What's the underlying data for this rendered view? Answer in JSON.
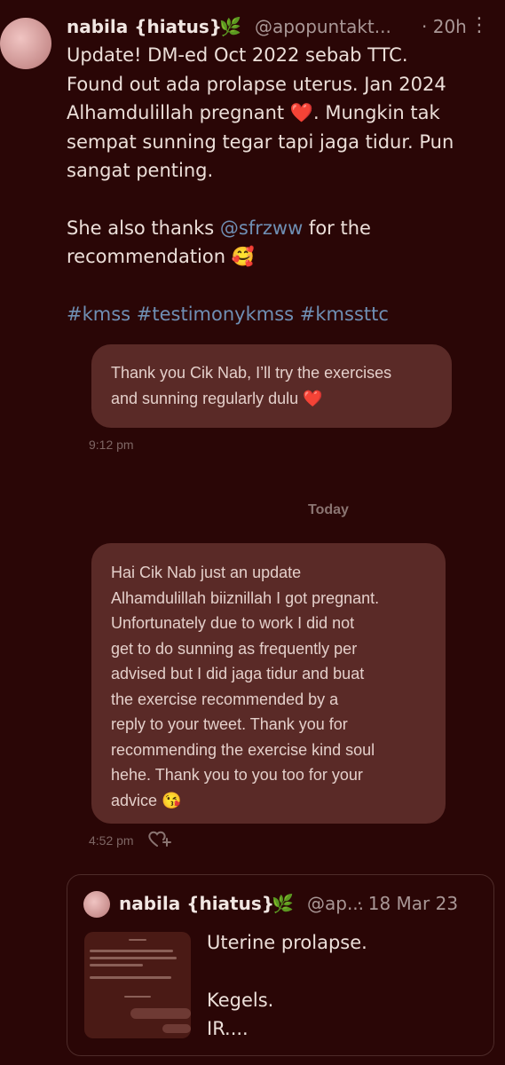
{
  "tweet": {
    "author_name": "nabila {hiatus}",
    "author_emoji": "🌿",
    "handle": "@apopuntakt...",
    "time": "· 20h",
    "more_glyph": "⋮",
    "line1": "Update! DM-ed Oct 2022 sebab TTC.",
    "line2": "Found out ada prolapse uterus. Jan 2024",
    "line3_text": "Alhamdulillah pregnant",
    "line3_emoji": "❤️",
    "line3_end": ". Mungkin tak",
    "line4": "sempat sunning tegar tapi jaga tidur. Pun",
    "line5": "sangat penting.",
    "thanks_pre": "She also thanks ",
    "thanks_mention": "@sfrzww",
    "thanks_post": " for the",
    "thanks_line2": "recommendation 🥰",
    "hashtag1": "#kmss",
    "hashtag2": "#testimonykmss",
    "hashtag3": "#kmssttc"
  },
  "chat": {
    "msg1_line1": "Thank you Cik Nab, I’ll try the exercises",
    "msg1_line2": "and sunning regularly dulu ❤️",
    "msg1_time": "9:12 pm",
    "divider": "Today",
    "msg2_lines": [
      "Hai Cik Nab just an update",
      "Alhamdulillah biiznillah I got pregnant.",
      "Unfortunately due to work I did not",
      "get to do sunning as frequently per",
      "advised but I did jaga tidur and buat",
      "the exercise recommended by a",
      "reply to your tweet. Thank you for",
      "recommending the exercise kind soul",
      "hehe. Thank you to you too for your",
      "advice 😘"
    ],
    "msg2_time": "4:52 pm",
    "react_icon": "add-reaction-icon"
  },
  "quote": {
    "author_name": "nabila {hiatus}",
    "author_emoji": "🌿",
    "handle": "@ap...",
    "time": "· 18 Mar 23",
    "line1": "Uterine prolapse.",
    "line2": "Kegels.",
    "line3": "IR...."
  }
}
